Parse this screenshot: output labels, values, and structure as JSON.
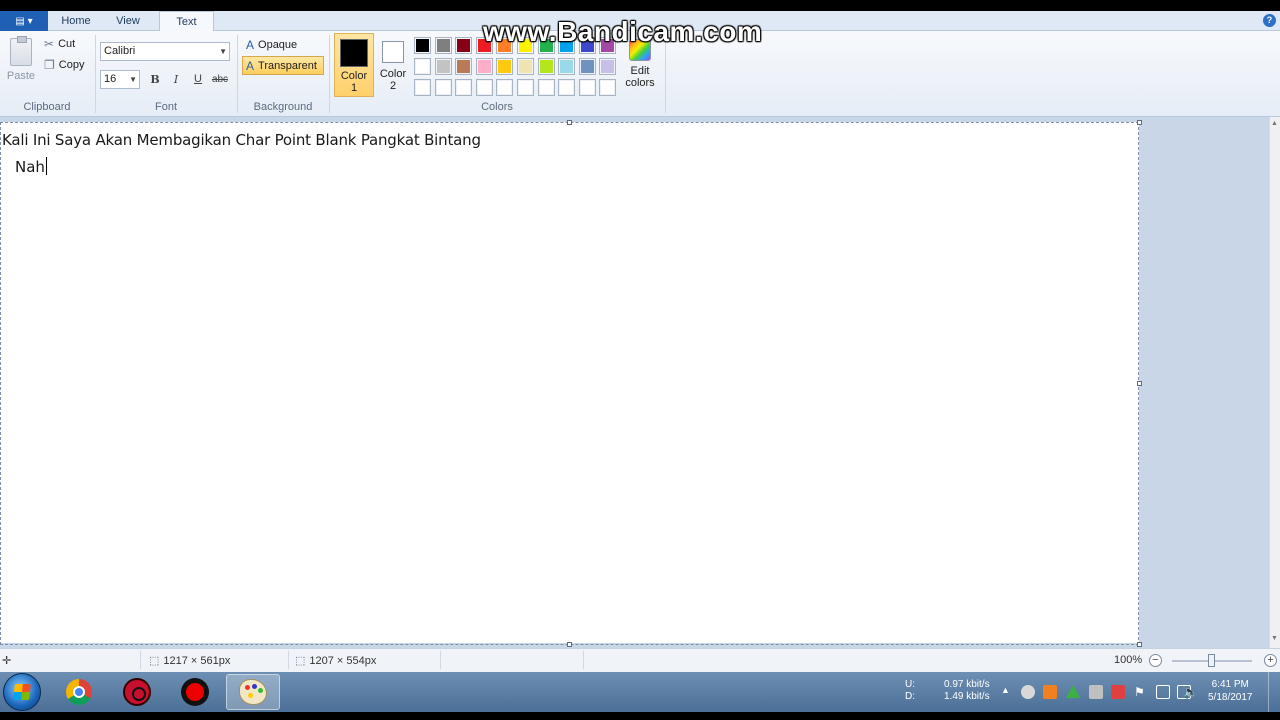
{
  "ribbon": {
    "file_label": "▤ ▾",
    "tabs": [
      {
        "label": "Home"
      },
      {
        "label": "View"
      },
      {
        "label": "Text"
      }
    ],
    "clipboard": {
      "paste": "Paste",
      "cut": "Cut",
      "copy": "Copy",
      "group_label": "Clipboard"
    },
    "font": {
      "family": "Calibri",
      "size": "16",
      "bold": "B",
      "italic": "I",
      "underline": "U",
      "strike": "abc",
      "group_label": "Font"
    },
    "background": {
      "opaque": "Opaque",
      "transparent": "Transparent",
      "group_label": "Background"
    },
    "colors": {
      "color1_line1": "Color",
      "color1_line2": "1",
      "color2_line1": "Color",
      "color2_line2": "2",
      "edit_line1": "Edit",
      "edit_line2": "colors",
      "group_label": "Colors",
      "palette_row1": [
        "#000000",
        "#7f7f7f",
        "#880015",
        "#ed1c24",
        "#ff7f27",
        "#fff200",
        "#22b14c",
        "#00a2e8",
        "#3f48cc",
        "#a349a4"
      ],
      "palette_row2": [
        "#ffffff",
        "#c3c3c3",
        "#b97a57",
        "#ffaec9",
        "#ffc90e",
        "#efe4b0",
        "#b5e61d",
        "#99d9ea",
        "#7092be",
        "#c8bfe7"
      ],
      "palette_row3": [
        "",
        "",
        "",
        "",
        "",
        "",
        "",
        "",
        "",
        ""
      ]
    }
  },
  "watermark": "www.Bandicam.com",
  "canvas": {
    "line1": "Kali Ini Saya Akan Membagikan Char Point Blank Pangkat Bintang",
    "line2": "Nah"
  },
  "status": {
    "selection_size": "1217 × 561px",
    "canvas_size": "1207 × 554px",
    "zoom": "100%"
  },
  "tray": {
    "up_label": "U:",
    "down_label": "D:",
    "up_value": "0.97 kbit/s",
    "down_value": "1.49 kbit/s",
    "time": "6:41 PM",
    "date": "5/18/2017"
  }
}
